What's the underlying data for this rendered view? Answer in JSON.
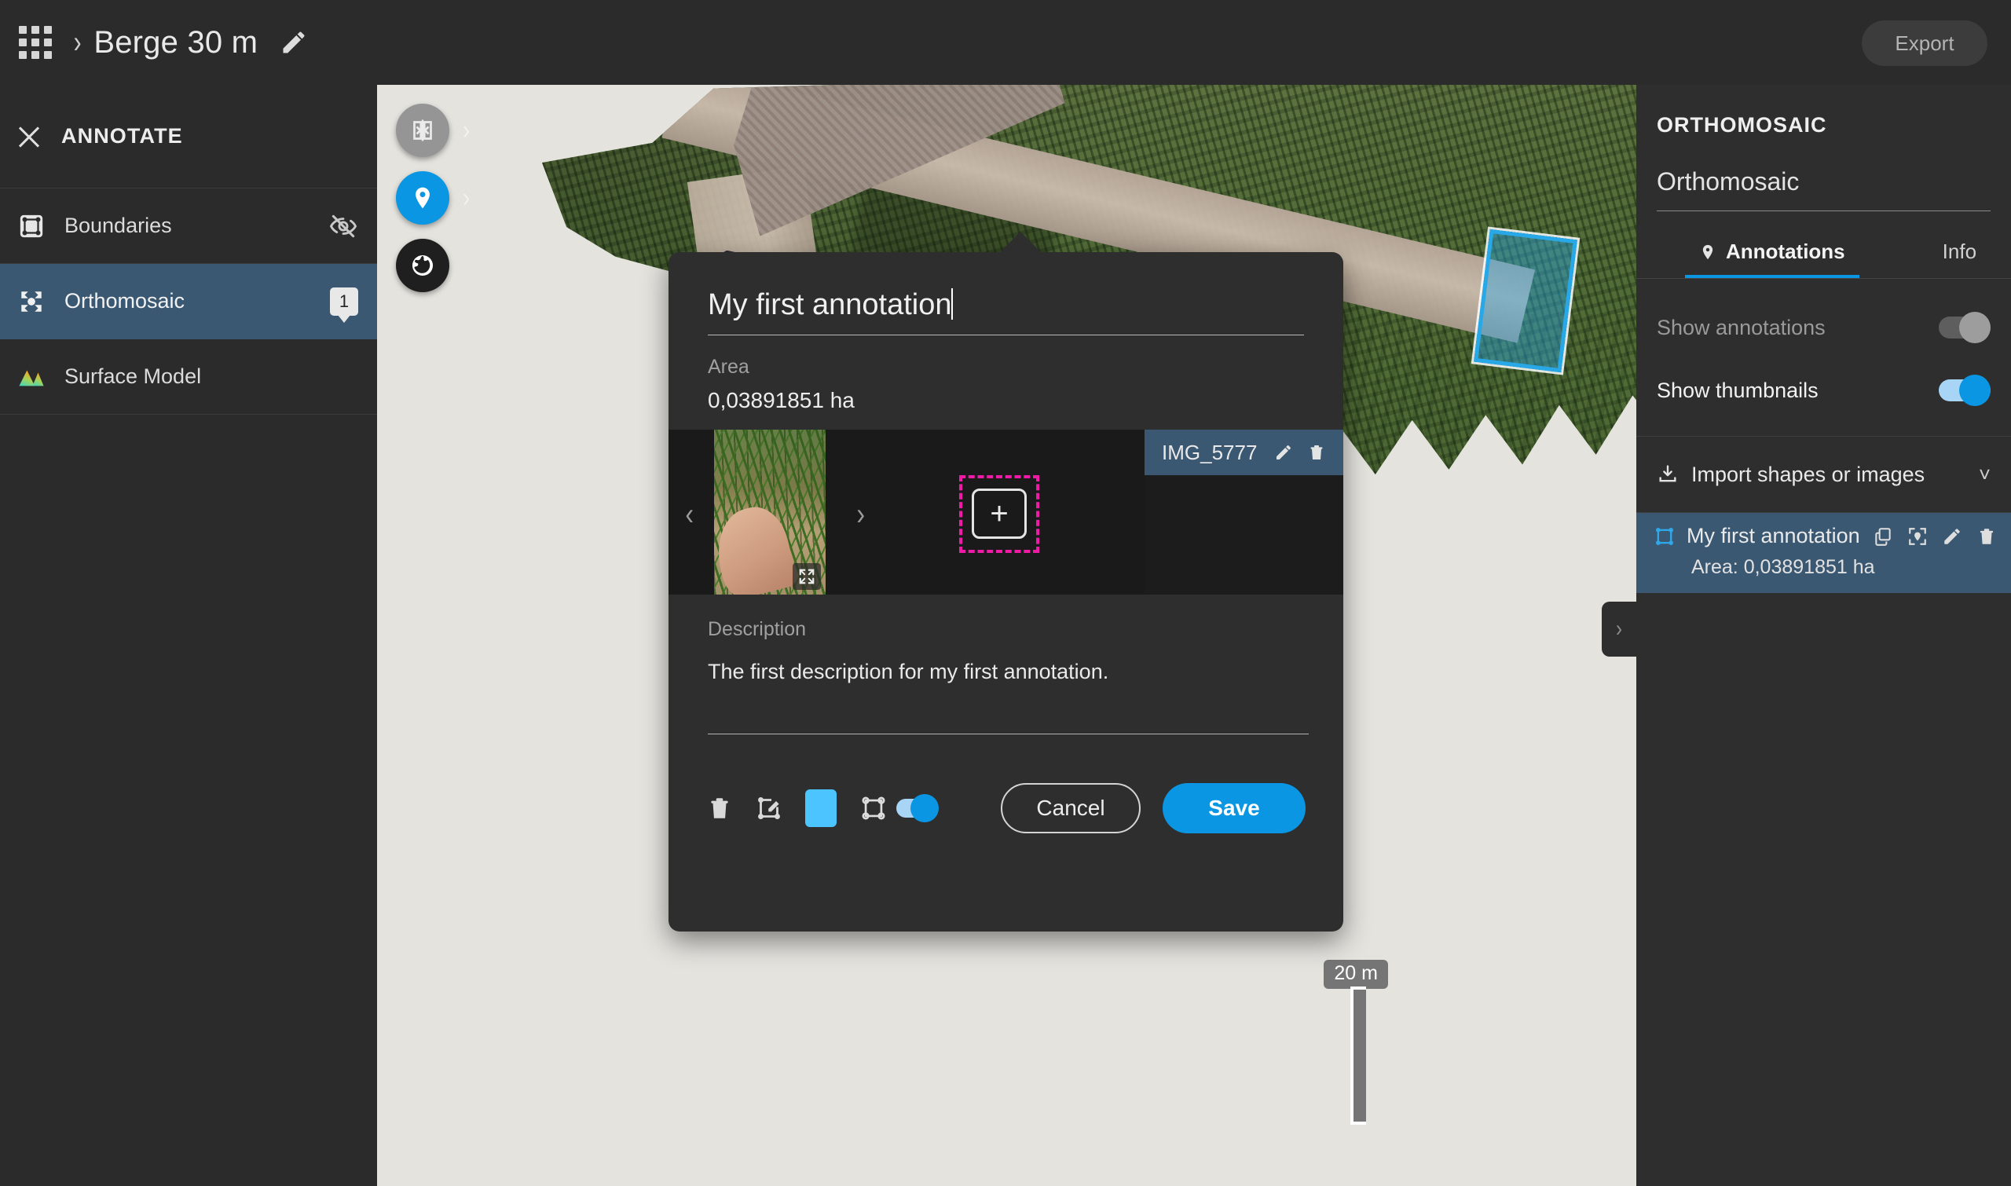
{
  "topbar": {
    "apps_icon": "grid-apps-icon",
    "breadcrumb_separator": "›",
    "project_title": "Berge 30 m",
    "edit_icon": "pencil-icon",
    "export_label": "Export"
  },
  "sidebar": {
    "header": {
      "close_icon": "close-icon",
      "label": "ANNOTATE"
    },
    "layers": [
      {
        "icon": "boundaries-icon",
        "label": "Boundaries",
        "action_icon": "eye-off-icon",
        "selected": false,
        "badge": null
      },
      {
        "icon": "orthomosaic-icon",
        "label": "Orthomosaic",
        "action_icon": null,
        "selected": true,
        "badge": "1"
      },
      {
        "icon": "surface-model-icon",
        "label": "Surface Model",
        "action_icon": null,
        "selected": false,
        "badge": null
      }
    ]
  },
  "map": {
    "tools": [
      {
        "icon": "split-view-icon",
        "color": "#959595",
        "has_chevron": true
      },
      {
        "icon": "map-pin-icon",
        "color": "#0a96e3",
        "has_chevron": true
      },
      {
        "icon": "globe-icon",
        "color": "#1f1f1f",
        "has_chevron": false
      }
    ],
    "collapse_icon": "chevron-right-icon",
    "scale_label": "20 m",
    "annotation_shape": "selected-polygon"
  },
  "right_panel": {
    "title": "ORTHOMOSAIC",
    "subtitle": "Orthomosaic",
    "tabs": [
      {
        "label": "Annotations",
        "icon": "map-pin-icon",
        "active": true
      },
      {
        "label": "Info",
        "icon": null,
        "active": false
      }
    ],
    "toggles": [
      {
        "label": "Show annotations",
        "state": "off"
      },
      {
        "label": "Show thumbnails",
        "state": "on"
      }
    ],
    "import": {
      "icon": "upload-icon",
      "label": "Import shapes or images",
      "chevron": "chevron-down-icon"
    },
    "annotations": [
      {
        "shape_icon": "polygon-icon",
        "name": "My first annotation",
        "area": "Area: 0,03891851 ha",
        "actions": [
          "copy-icon",
          "locate-icon",
          "pencil-icon",
          "trash-icon"
        ]
      }
    ]
  },
  "dialog": {
    "title_value": "My first annotation",
    "title_placeholder": "Name",
    "area_label": "Area",
    "area_value": "0,03891851 ha",
    "gallery": {
      "prev_icon": "chevron-left-icon",
      "next_icon": "chevron-right-icon",
      "expand_icon": "expand-icon",
      "add_icon": "add-photo-icon",
      "image_name": "IMG_5777",
      "image_actions": [
        "pencil-icon",
        "trash-icon"
      ]
    },
    "description_label": "Description",
    "description_value": "The first description for my first annotation.",
    "footer": {
      "delete_icon": "trash-icon",
      "edit_shape_icon": "edit-shape-icon",
      "color_swatch": "#4bc4ff",
      "shape_icon": "polygon-icon",
      "shape_toggle_state": "on",
      "cancel_label": "Cancel",
      "save_label": "Save"
    }
  },
  "colors": {
    "accent": "#0a96e3",
    "selection": "#3b5872",
    "panel_bg": "#2e2e2e",
    "sidebar_bg": "#2b2b2b",
    "map_bg": "#e4e3de",
    "focus_ring": "#ef1ba6"
  }
}
